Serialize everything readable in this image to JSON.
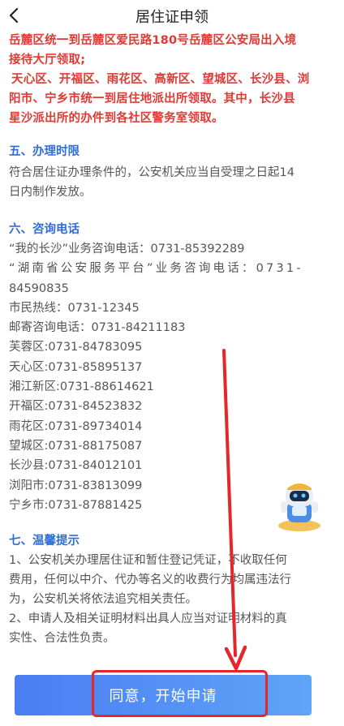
{
  "header": {
    "title": "居住证申领",
    "back_icon": "chevron-left-icon"
  },
  "notice_red": [
    "岳麓区统一到岳麓区爱民路180号岳麓区公安局出入境",
    "接待大厅领取;",
    "天心区、开福区、雨花区、高新区、望城区、长沙县、浏",
    "阳市、宁乡市统一到居住地派出所领取。其中，长沙县",
    "星沙派出所的办件到各社区警务室领取。"
  ],
  "section5": {
    "heading": "五、办理时限",
    "lines": [
      "符合居住证办理条件的，公安机关应当自受理之日起14",
      "日内制作发放。"
    ]
  },
  "section6": {
    "heading": "六、咨询电话",
    "lines": [
      "“我的长沙”业务咨询电话：0731-85392289",
      "“湖南省公安服务平台”业务咨询电话：0731-",
      "84590835",
      "市民热线：0731-12345",
      "邮寄咨询电话：0731-84211183",
      "芙蓉区:0731-84783095",
      "天心区:0731-85895137",
      "湘江新区:0731-88614621",
      "开福区:0731-84523832",
      "雨花区:0731-89734014",
      "望城区:0731-88175087",
      "长沙县:0731-84012101",
      "浏阳市:0731-83813099",
      "宁乡市:0731-87881425"
    ]
  },
  "section7": {
    "heading": "七、温馨提示",
    "lines": [
      " 1、公安机关办理居住证和暂住登记凭证，不收取任何",
      "费用，任何以中介、代办等名义的收费行为均属违法行",
      "为，公安机关将依法追究相关责任。",
      " 2、申请人及相关证明材料出具人应当对证明材料的真",
      "实性、合法性负责。"
    ]
  },
  "action": {
    "agree_label": "同意，开始申请"
  },
  "colors": {
    "red_text": "#e03a35",
    "heading_blue": "#2f6ed8",
    "button_start": "#4a7df2",
    "button_end": "#5fa4f8",
    "annotation_red": "#e5262a"
  },
  "mascot_icon": "robot-mascot-icon",
  "annotation_arrow": "down-arrow-icon"
}
